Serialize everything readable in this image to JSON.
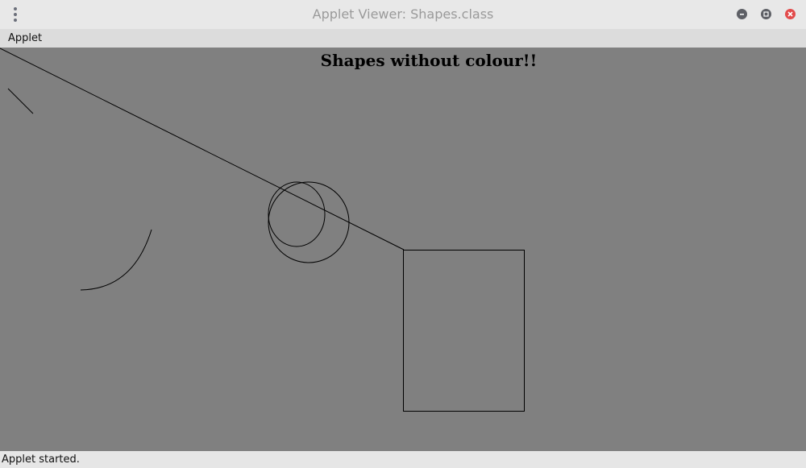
{
  "window": {
    "title": "Applet Viewer: Shapes.class",
    "close_color": "#e24b4b"
  },
  "menu": {
    "items": [
      "Applet"
    ]
  },
  "applet": {
    "heading": "Shapes without colour!!",
    "background": "#808080",
    "stroke": "#000000",
    "shapes": [
      "line",
      "line",
      "arc",
      "oval",
      "oval",
      "rectangle"
    ]
  },
  "status": {
    "text": "Applet started."
  }
}
